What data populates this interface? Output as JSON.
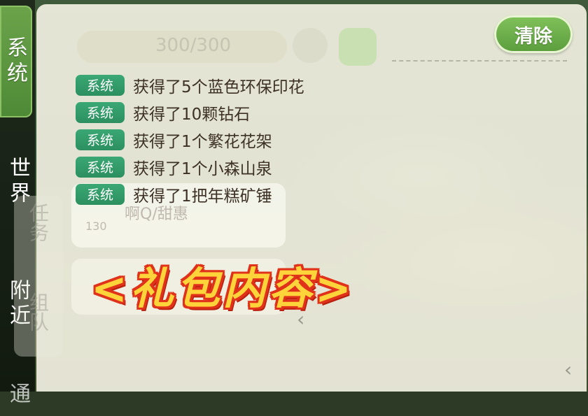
{
  "sidebar": {
    "tabs": [
      {
        "label": "系统",
        "active": true
      },
      {
        "label": "世界",
        "active": false
      },
      {
        "label": "附近",
        "active": false
      },
      {
        "label": "通",
        "active": false
      }
    ]
  },
  "background": {
    "energy": "300/300",
    "quest_label": "任务",
    "team_label": "组队",
    "player_name": "啊Q/甜惠",
    "player_level": "130"
  },
  "panel": {
    "clear_label": "清除",
    "messages": [
      {
        "channel": "系统",
        "text": "获得了5个蓝色环保印花"
      },
      {
        "channel": "系统",
        "text": "获得了10颗钻石"
      },
      {
        "channel": "系统",
        "text": "获得了1个繁花花架"
      },
      {
        "channel": "系统",
        "text": "获得了1个小森山泉"
      },
      {
        "channel": "系统",
        "text": "获得了1把年糕矿锤"
      }
    ]
  },
  "overlay": {
    "caption": "<礼包内容>"
  },
  "colors": {
    "badge_green": "#2c8f5f",
    "button_green": "#5a9c3c",
    "caption_yellow": "#ffd33a",
    "caption_red": "#e0321a"
  }
}
